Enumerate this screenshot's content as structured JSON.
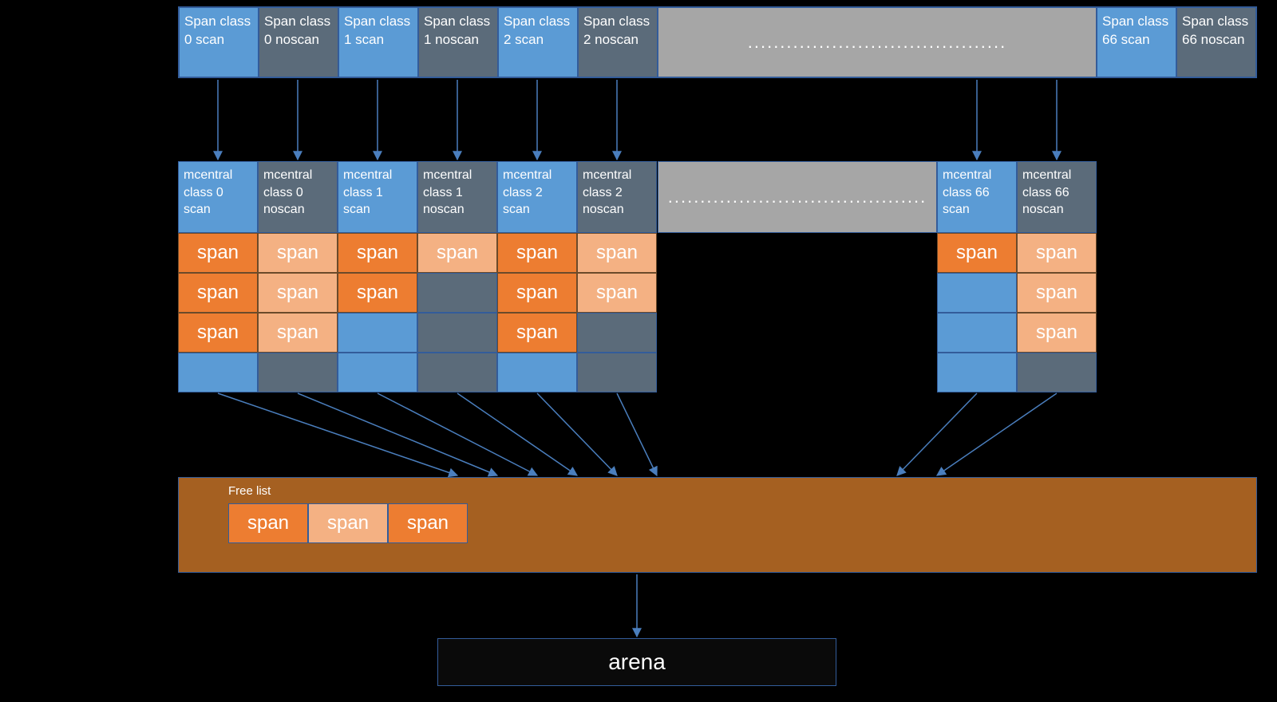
{
  "top": [
    {
      "label": "Span class 0 scan",
      "variant": "blue"
    },
    {
      "label": "Span class 0 noscan",
      "variant": "gray"
    },
    {
      "label": "Span class 1 scan",
      "variant": "blue"
    },
    {
      "label": "Span class 1 noscan",
      "variant": "gray"
    },
    {
      "label": "Span class 2 scan",
      "variant": "blue"
    },
    {
      "label": "Span class 2 noscan",
      "variant": "gray"
    }
  ],
  "top_tail": [
    {
      "label": "Span class 66 scan",
      "variant": "blue"
    },
    {
      "label": "Span class 66 noscan",
      "variant": "gray"
    }
  ],
  "ellipsis": "........................................",
  "mc_left": [
    {
      "label": "mcentral class 0 scan",
      "variant": "blue",
      "spans": [
        "dark",
        "dark",
        "dark",
        ""
      ]
    },
    {
      "label": "mcentral class 0 noscan",
      "variant": "gray",
      "spans": [
        "light",
        "light",
        "light",
        ""
      ]
    },
    {
      "label": "mcentral class 1 scan",
      "variant": "blue",
      "spans": [
        "dark",
        "dark",
        "",
        ""
      ]
    },
    {
      "label": "mcentral class 1 noscan",
      "variant": "gray",
      "spans": [
        "light",
        "",
        "",
        ""
      ]
    },
    {
      "label": "mcentral class 2 scan",
      "variant": "blue",
      "spans": [
        "dark",
        "dark",
        "dark",
        ""
      ]
    },
    {
      "label": "mcentral class 2 noscan",
      "variant": "gray",
      "spans": [
        "light",
        "light",
        "",
        ""
      ]
    }
  ],
  "mc_right": [
    {
      "label": "mcentral class 66 scan",
      "variant": "blue",
      "spans": [
        "dark",
        "",
        "",
        ""
      ]
    },
    {
      "label": "mcentral class 66 noscan",
      "variant": "gray",
      "spans": [
        "light",
        "light",
        "light",
        ""
      ]
    }
  ],
  "span_label": "span",
  "free_list_label": "Free list",
  "free_list": [
    "dark",
    "light",
    "dark"
  ],
  "arena": "arena"
}
